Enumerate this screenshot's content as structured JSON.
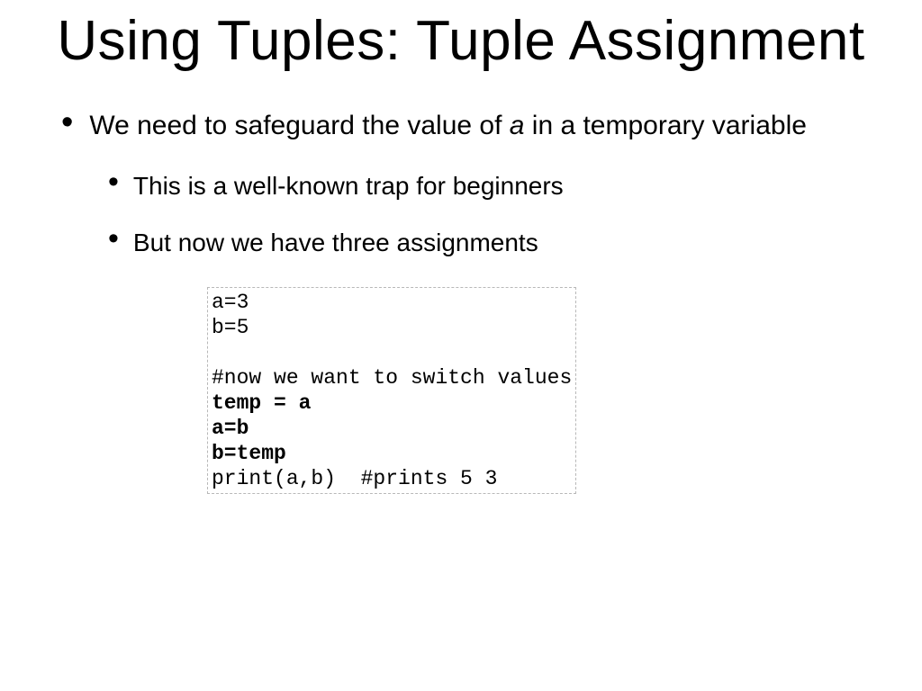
{
  "title": "Using Tuples: Tuple Assignment",
  "bullets": {
    "l1_pre": "We need to safeguard the value of ",
    "l1_italic": "a",
    "l1_post": " in a temporary variable",
    "l2a": "This is a well-known trap for beginners",
    "l2b": "But now we have three assignments"
  },
  "code": {
    "line1": "a=3",
    "line2": "b=5",
    "line_blank": " ",
    "line3": "#now we want to switch values",
    "line4": "temp = a",
    "line5": "a=b",
    "line6": "b=temp",
    "line7": "print(a,b)  #prints 5 3"
  }
}
